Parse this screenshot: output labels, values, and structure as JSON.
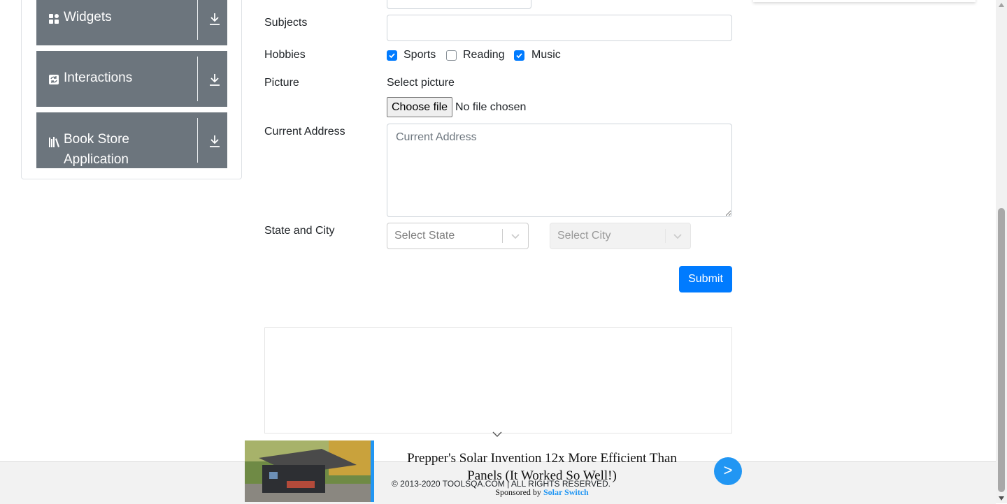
{
  "sidebar": {
    "groups": [
      {
        "label": "Widgets",
        "icon": "widgets-icon"
      },
      {
        "label": "Interactions",
        "icon": "interactions-icon"
      },
      {
        "label": "Book Store",
        "label2": "Application",
        "icon": "book-store-icon"
      }
    ]
  },
  "form": {
    "subjects_label": "Subjects",
    "subjects_value": "",
    "hobbies_label": "Hobbies",
    "hobbies": [
      {
        "label": "Sports",
        "checked": true
      },
      {
        "label": "Reading",
        "checked": false
      },
      {
        "label": "Music",
        "checked": true
      }
    ],
    "picture_label": "Picture",
    "picture_prompt": "Select picture",
    "file_button": "Choose file",
    "file_status": "No file chosen",
    "address_label": "Current Address",
    "address_placeholder": "Current Address",
    "state_city_label": "State and City",
    "state_placeholder": "Select State",
    "city_placeholder": "Select City",
    "submit_label": "Submit"
  },
  "ad": {
    "headline": "Prepper's Solar Invention 12x More Efficient Than Panels (It Worked So Well!)",
    "sponsored_by": "Sponsored by",
    "sponsor_name": "Solar Switch",
    "go_label": ">"
  },
  "footer": {
    "copyright": "© 2013-2020 TOOLSQA.COM | ALL RIGHTS RESERVED."
  },
  "colors": {
    "accent": "#007bff",
    "sidebar_group": "#6c757d",
    "ad_accent": "#2196f3"
  }
}
